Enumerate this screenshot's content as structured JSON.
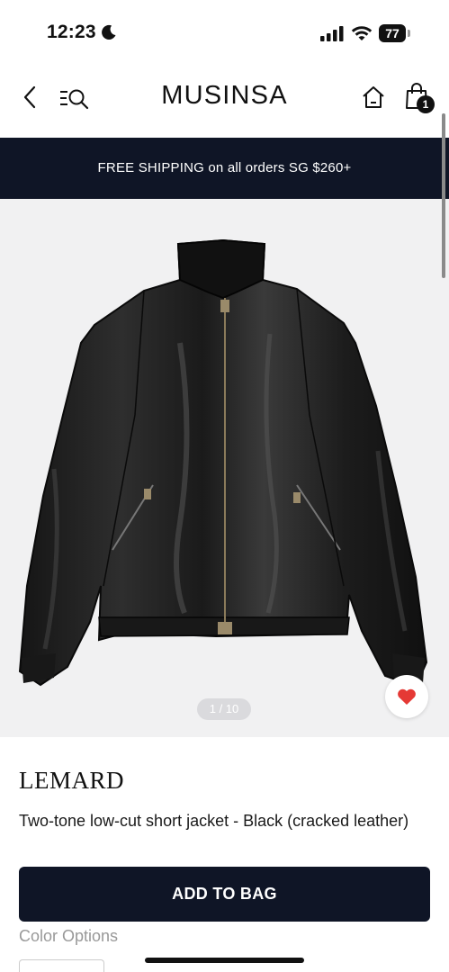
{
  "status_bar": {
    "time": "12:23",
    "battery_level": "77",
    "icons": [
      "moon-icon",
      "signal-icon",
      "wifi-icon",
      "battery-icon"
    ]
  },
  "header": {
    "logo": "MUSINSA",
    "bag_count": "1",
    "icons": [
      "back-arrow-icon",
      "menu-search-icon",
      "home-icon",
      "shopping-bag-icon"
    ]
  },
  "banner": {
    "text": "FREE SHIPPING on all orders SG $260+"
  },
  "gallery": {
    "pager": "1 / 10",
    "current_page": 1,
    "total_pages": 10,
    "wishlist_icon": "heart-icon"
  },
  "product": {
    "brand": "LEMARD",
    "name": "Two-tone low-cut short jacket - Black (cracked leather)",
    "add_to_bag_label": "ADD TO BAG",
    "color_options_label": "Color Options"
  },
  "colors": {
    "banner_bg": "#0f1526",
    "button_bg": "#0f1526",
    "heart": "#e53935",
    "image_bg": "#f1f1f2"
  }
}
